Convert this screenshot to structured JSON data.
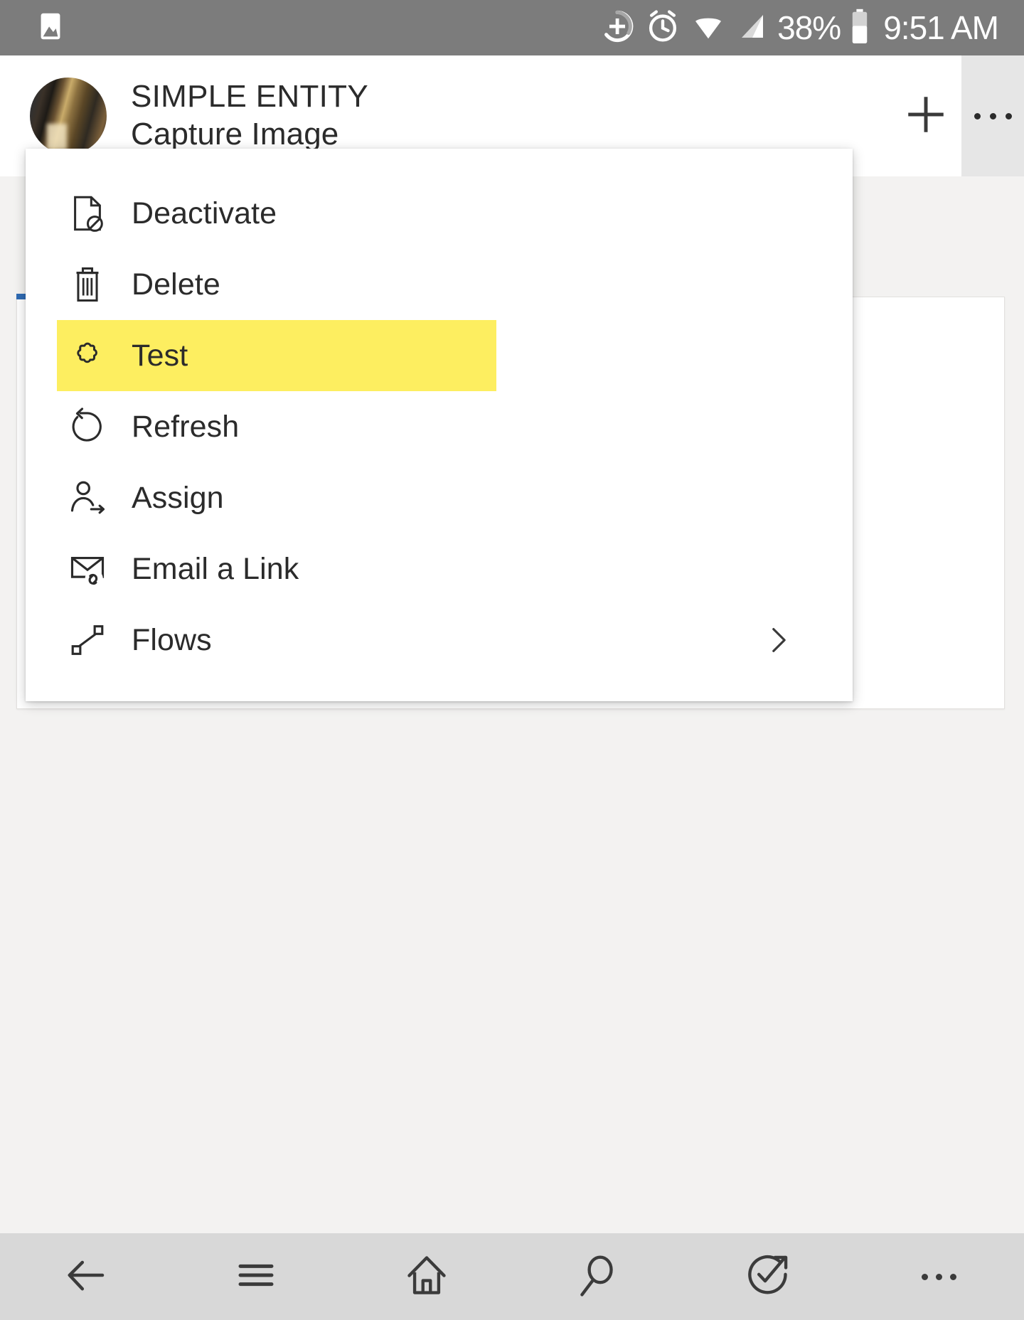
{
  "status_bar": {
    "left_icon": "image-notification-icon",
    "icons": [
      "data-saver-plus-icon",
      "alarm-icon",
      "wifi-icon",
      "cellular-signal-icon"
    ],
    "battery_percent": "38%",
    "battery_icon": "battery-icon",
    "time": "9:51 AM",
    "background_color": "#7c7c7c",
    "foreground_color": "#ffffff"
  },
  "app_bar": {
    "avatar": "record-image-avatar",
    "entity_label": "SIMPLE ENTITY",
    "record_title": "Capture Image",
    "new_button": "+",
    "more_button": "more-command-button",
    "more_button_active_color": "#e6e6e6"
  },
  "flyout_menu": {
    "highlight_color": "#fdee60",
    "items": [
      {
        "label": "Deactivate",
        "icon": "page-blocked-icon",
        "highlighted": false,
        "has_submenu": false
      },
      {
        "label": "Delete",
        "icon": "trash-icon",
        "highlighted": false,
        "has_submenu": false
      },
      {
        "label": "Test",
        "icon": "puzzle-piece-icon",
        "highlighted": true,
        "has_submenu": false
      },
      {
        "label": "Refresh",
        "icon": "refresh-icon",
        "highlighted": false,
        "has_submenu": false
      },
      {
        "label": "Assign",
        "icon": "assign-user-icon",
        "highlighted": false,
        "has_submenu": false
      },
      {
        "label": "Email a Link",
        "icon": "email-link-icon",
        "highlighted": false,
        "has_submenu": false
      },
      {
        "label": "Flows",
        "icon": "flows-icon",
        "highlighted": false,
        "has_submenu": true,
        "submenu_icon": "chevron-right-icon"
      }
    ]
  },
  "page_body": {
    "card_accent_color": "#2f6bb3",
    "background_color": "#f3f2f1"
  },
  "bottom_nav": {
    "background_color": "#d8d8d8",
    "items": [
      {
        "icon": "back-arrow-icon",
        "name": "nav-back"
      },
      {
        "icon": "hamburger-menu-icon",
        "name": "nav-menu"
      },
      {
        "icon": "home-icon",
        "name": "nav-home"
      },
      {
        "icon": "search-icon",
        "name": "nav-search"
      },
      {
        "icon": "assistant-check-arrow-icon",
        "name": "nav-assistant"
      },
      {
        "icon": "overflow-dots-icon",
        "name": "nav-more"
      }
    ]
  }
}
